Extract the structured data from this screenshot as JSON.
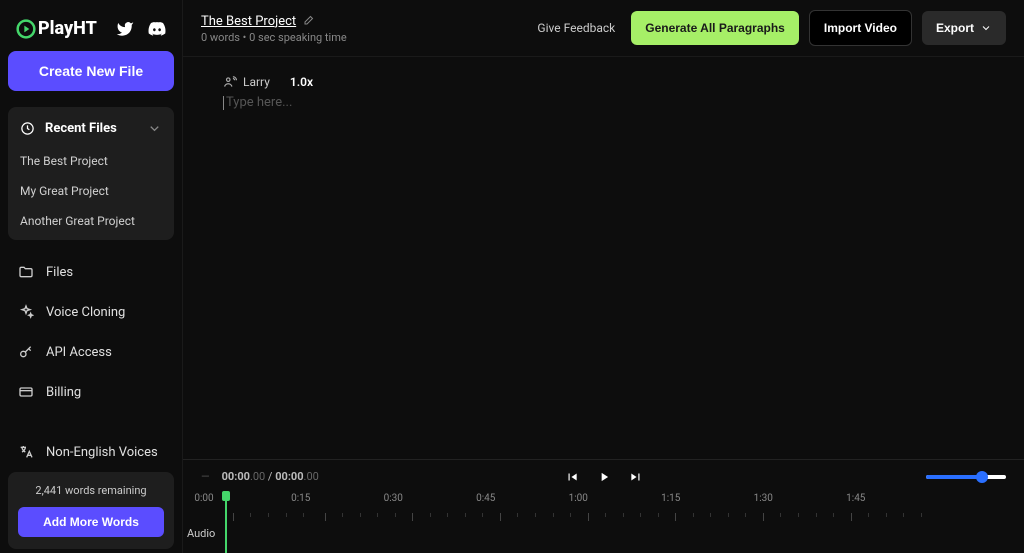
{
  "brand": "PlayHT",
  "sidebar": {
    "create_label": "Create New File",
    "recent_label": "Recent Files",
    "recent_items": [
      "The Best Project",
      "My Great Project",
      "Another Great Project"
    ],
    "nav": {
      "files": "Files",
      "voice_cloning": "Voice Cloning",
      "api": "API Access",
      "billing": "Billing",
      "non_english": "Non-English Voices"
    },
    "quota": {
      "remaining": "2,441 words remaining",
      "add_label": "Add More Words"
    }
  },
  "header": {
    "project_title": "The Best Project",
    "project_sub": "0 words • 0 sec speaking time",
    "feedback": "Give Feedback",
    "generate": "Generate All Paragraphs",
    "import": "Import Video",
    "export": "Export"
  },
  "editor": {
    "voice_name": "Larry",
    "speed": "1.0x",
    "placeholder": "Type here..."
  },
  "timeline": {
    "time_current": "00:00",
    "time_current_ms": ".00",
    "time_total": "00:00",
    "time_total_ms": ".00",
    "track_label": "Audio",
    "labels": [
      "0:00",
      "0:15",
      "0:30",
      "0:45",
      "1:00",
      "1:15",
      "1:30",
      "1:45"
    ]
  }
}
